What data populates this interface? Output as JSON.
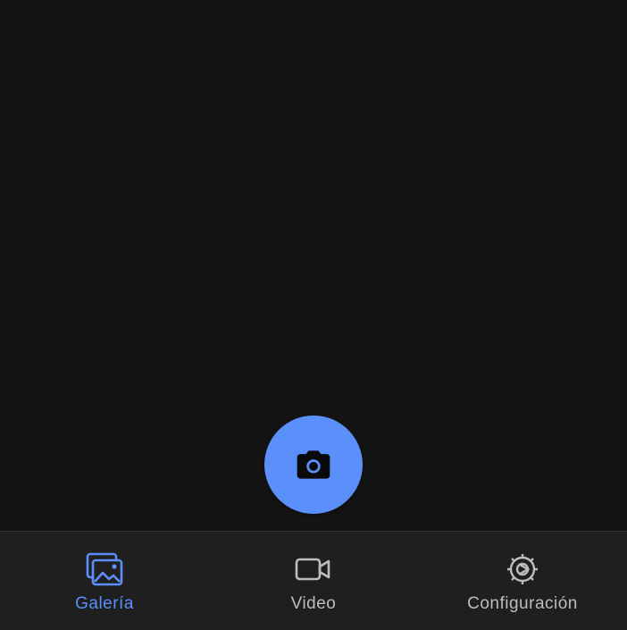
{
  "theme": {
    "accent": "#5B8FF9",
    "background": "#141414",
    "nav_background": "#1f1f1f",
    "inactive": "#bdbdbd"
  },
  "shutter": {
    "icon": "camera-icon"
  },
  "bottom_nav": {
    "active_index": 0,
    "items": [
      {
        "label": "Galería",
        "icon": "gallery-icon"
      },
      {
        "label": "Video",
        "icon": "video-camera-icon"
      },
      {
        "label": "Configuración",
        "icon": "settings-gear-icon"
      }
    ]
  }
}
